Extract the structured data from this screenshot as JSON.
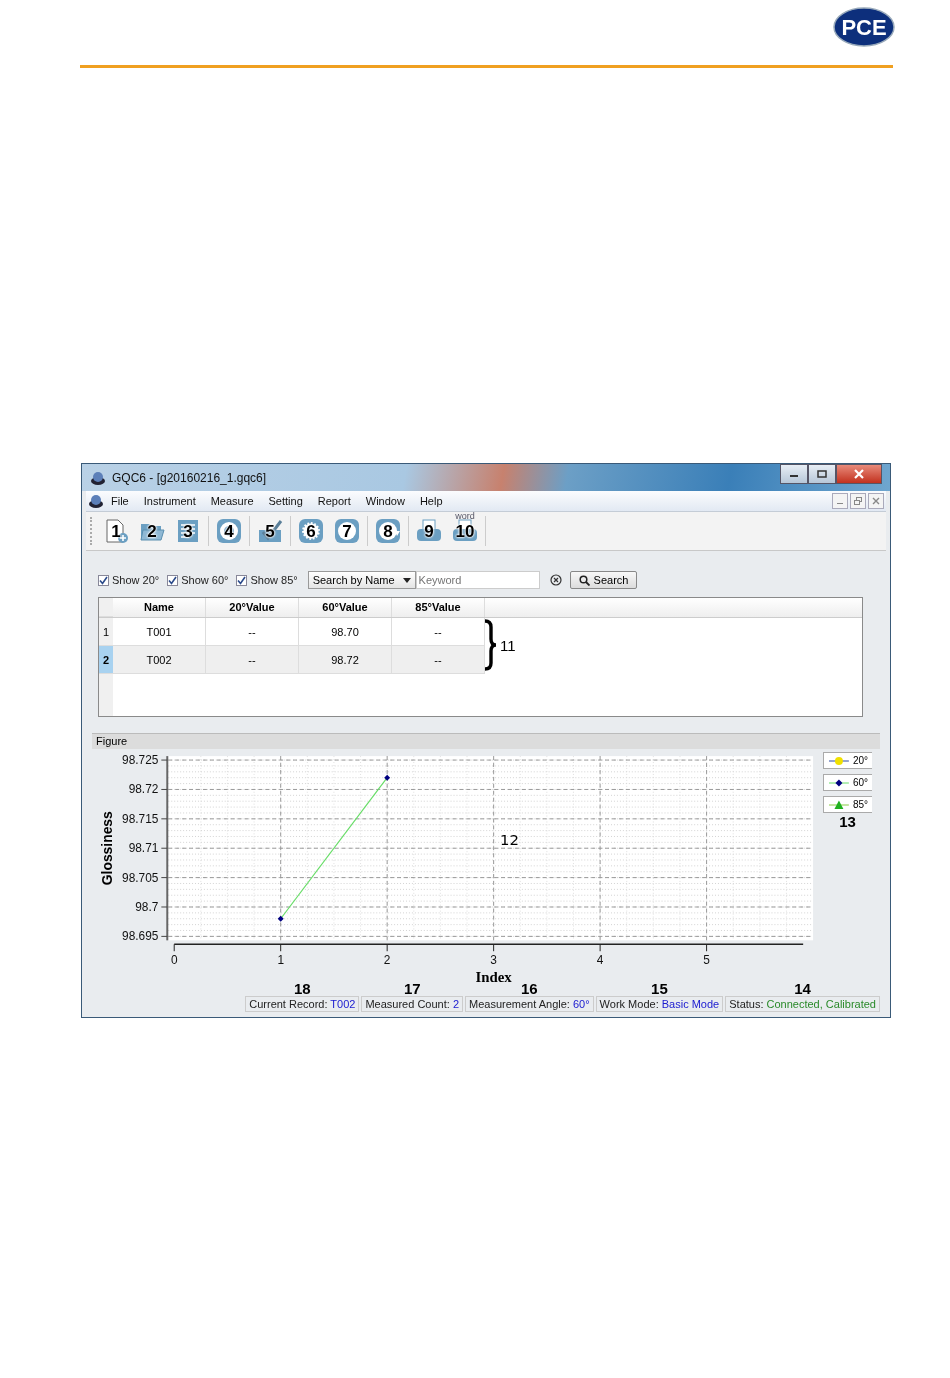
{
  "header": {
    "logo": "PCE"
  },
  "window": {
    "title": "GQC6 - [g20160216_1.gqc6]"
  },
  "menu": [
    "File",
    "Instrument",
    "Measure",
    "Setting",
    "Report",
    "Window",
    "Help"
  ],
  "toolbar": [
    [
      {
        "kind": "new",
        "number": "1"
      },
      {
        "kind": "open",
        "number": "2"
      },
      {
        "kind": "list",
        "number": "3"
      }
    ],
    [
      {
        "kind": "disc",
        "number": "4"
      }
    ],
    [
      {
        "kind": "check",
        "number": "5"
      }
    ],
    [
      {
        "kind": "dial",
        "number": "6"
      },
      {
        "kind": "badge",
        "number": "7"
      }
    ],
    [
      {
        "kind": "cycle",
        "number": "8"
      }
    ],
    [
      {
        "kind": "print",
        "number": "9"
      },
      {
        "kind": "print",
        "number": "10",
        "caption": "word"
      }
    ]
  ],
  "filters": [
    {
      "label": "Show 20°",
      "checked": true
    },
    {
      "label": "Show 60°",
      "checked": true
    },
    {
      "label": "Show 85°",
      "checked": true
    }
  ],
  "search": {
    "mode": "Search by Name",
    "placeholder": "Keyword",
    "button": "Search"
  },
  "table": {
    "columns": [
      "Name",
      "20°Value",
      "60°Value",
      "85°Value"
    ],
    "rows": [
      {
        "index": "1",
        "cells": [
          "T001",
          "--",
          "98.70",
          "--"
        ],
        "selected": false
      },
      {
        "index": "2",
        "cells": [
          "T002",
          "--",
          "98.72",
          "--"
        ],
        "selected": true
      }
    ],
    "callout": "11"
  },
  "figure": {
    "title": "Figure",
    "callout": "12",
    "legend_callout": "13",
    "markers": [
      {
        "color": "#f0e000"
      },
      {
        "color": "#000080"
      },
      {
        "color": "#20b020"
      }
    ],
    "chart_data": {
      "type": "line",
      "xlabel": "Index",
      "ylabel": "Glossiness",
      "x": [
        1,
        2
      ],
      "series": [
        {
          "name": "20°",
          "color": "#2a4aa0",
          "marker": "circle",
          "values": [
            null,
            null
          ]
        },
        {
          "name": "60°",
          "color": "#66dd66",
          "marker": "diamond",
          "values": [
            98.698,
            98.722
          ]
        },
        {
          "name": "85°",
          "color": "#88cc44",
          "marker": "triangle",
          "values": [
            null,
            null
          ]
        }
      ],
      "grid": true,
      "xlim": [
        0,
        6
      ],
      "ylim": [
        98.695,
        98.725
      ],
      "xticks": [
        0,
        1,
        2,
        3,
        4,
        5
      ],
      "yticks": [
        98.695,
        98.7,
        98.705,
        98.71,
        98.715,
        98.72,
        98.725
      ]
    }
  },
  "status_bar": [
    {
      "callout": "18",
      "label": "Current Record:",
      "value": "T002",
      "kind": "info"
    },
    {
      "callout": "17",
      "label": "Measured Count:",
      "value": "2",
      "kind": "info"
    },
    {
      "callout": "16",
      "label": "Measurement Angle:",
      "value": "60°",
      "kind": "info"
    },
    {
      "callout": "15",
      "label": "Work Mode:",
      "value": "Basic Mode",
      "kind": "info"
    },
    {
      "callout": "14",
      "label": "Status:",
      "value": "Connected, Calibrated",
      "kind": "ok"
    }
  ]
}
